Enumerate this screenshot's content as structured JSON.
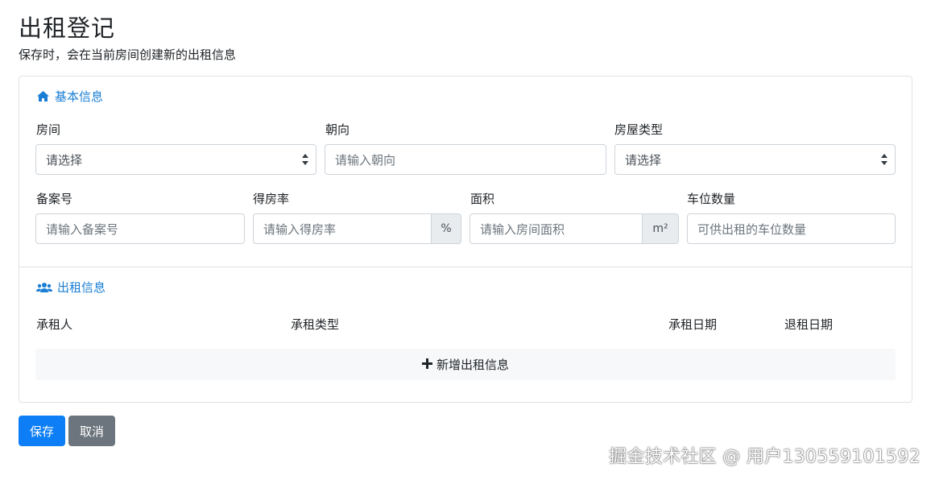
{
  "header": {
    "title": "出租登记",
    "subtitle": "保存时，会在当前房间创建新的出租信息"
  },
  "basic_section": {
    "title": "基本信息",
    "icon": "home-icon",
    "fields": {
      "room": {
        "label": "房间",
        "value": "请选择"
      },
      "orientation": {
        "label": "朝向",
        "placeholder": "请输入朝向"
      },
      "house_type": {
        "label": "房屋类型",
        "value": "请选择"
      },
      "record_no": {
        "label": "备案号",
        "placeholder": "请输入备案号"
      },
      "occupancy_rate": {
        "label": "得房率",
        "placeholder": "请输入得房率",
        "addon": "%"
      },
      "area": {
        "label": "面积",
        "placeholder": "请输入房间面积",
        "addon": "m²"
      },
      "parking": {
        "label": "车位数量",
        "placeholder": "可供出租的车位数量"
      }
    }
  },
  "rental_section": {
    "title": "出租信息",
    "icon": "users-icon",
    "columns": [
      "承租人",
      "承租类型",
      "承租日期",
      "退租日期"
    ],
    "add_label": "新增出租信息",
    "add_icon": "plus-icon"
  },
  "actions": {
    "save": "保存",
    "cancel": "取消"
  },
  "watermark": "掘金技术社区 @ 用户130559101592",
  "colors": {
    "accent": "#1a7fd4",
    "primary_button": "#0d7ef5",
    "secondary_button": "#6c757d",
    "border": "#dfe2e6"
  }
}
